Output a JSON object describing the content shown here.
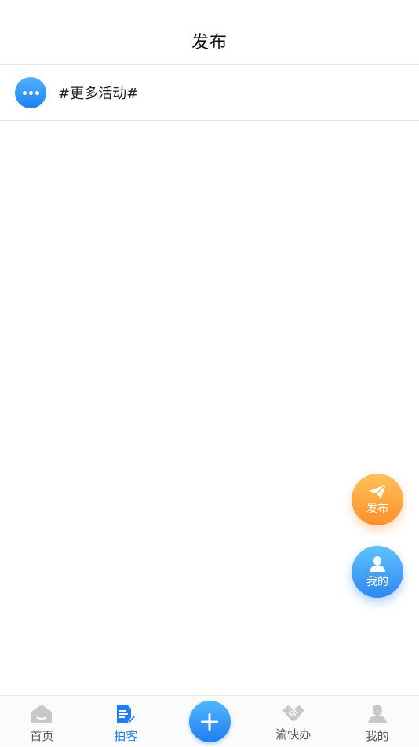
{
  "header": {
    "title": "发布"
  },
  "activity": {
    "label": "#更多活动#",
    "icon": "more-icon"
  },
  "fabs": {
    "publish": {
      "label": "发布",
      "icon": "paper-plane-icon",
      "color": "#ff9a33"
    },
    "mine": {
      "label": "我的",
      "icon": "user-icon",
      "color": "#2f86f0"
    }
  },
  "tabbar": {
    "active_color": "#1f7ff0",
    "tabs": [
      {
        "label": "首页",
        "icon": "home-icon"
      },
      {
        "label": "拍客",
        "icon": "note-edit-icon",
        "active": true
      },
      {
        "label": "",
        "icon": "plus-icon"
      },
      {
        "label": "渝快办",
        "icon": "handshake-icon"
      },
      {
        "label": "我的",
        "icon": "user-icon"
      }
    ]
  }
}
